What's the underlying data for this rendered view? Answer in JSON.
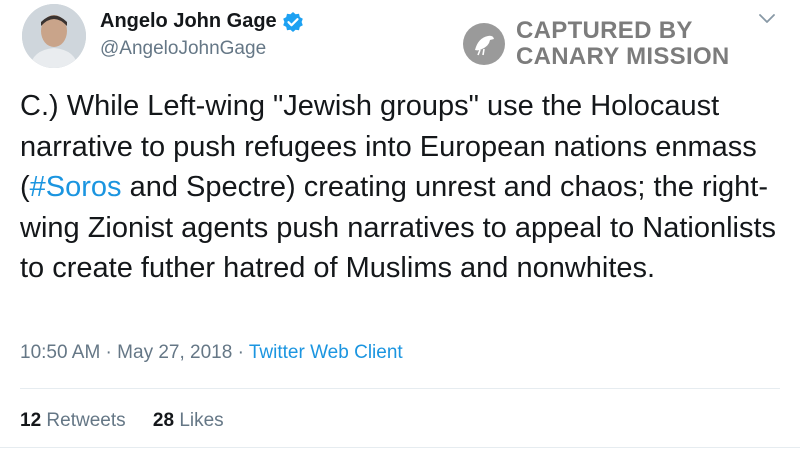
{
  "user": {
    "name": "Angelo John Gage",
    "handle": "@AngeloJohnGage"
  },
  "watermark": {
    "line1": "CAPTURED BY",
    "line2": "CANARY MISSION"
  },
  "tweet": {
    "text_before": "C.) While Left-wing \"Jewish groups\" use the Holocaust narrative to push refugees into European nations enmass (",
    "hashtag": "#Soros",
    "text_after": " and Spectre) creating unrest and chaos; the right-wing Zionist agents push narratives to appeal to Nationlists to create futher hatred of Muslims and nonwhites."
  },
  "meta": {
    "time": "10:50 AM",
    "separator": " · ",
    "date": "May 27, 2018",
    "client": "Twitter Web Client"
  },
  "stats": {
    "retweets_count": "12",
    "retweets_label": "Retweets",
    "likes_count": "28",
    "likes_label": "Likes"
  },
  "icons": {
    "verified": "verified-badge-icon",
    "chevron": "chevron-down-icon",
    "watermark_logo": "canary-logo-icon"
  },
  "colors": {
    "link": "#1b95e0",
    "secondary_text": "#657786",
    "verified": "#1da1f2"
  }
}
